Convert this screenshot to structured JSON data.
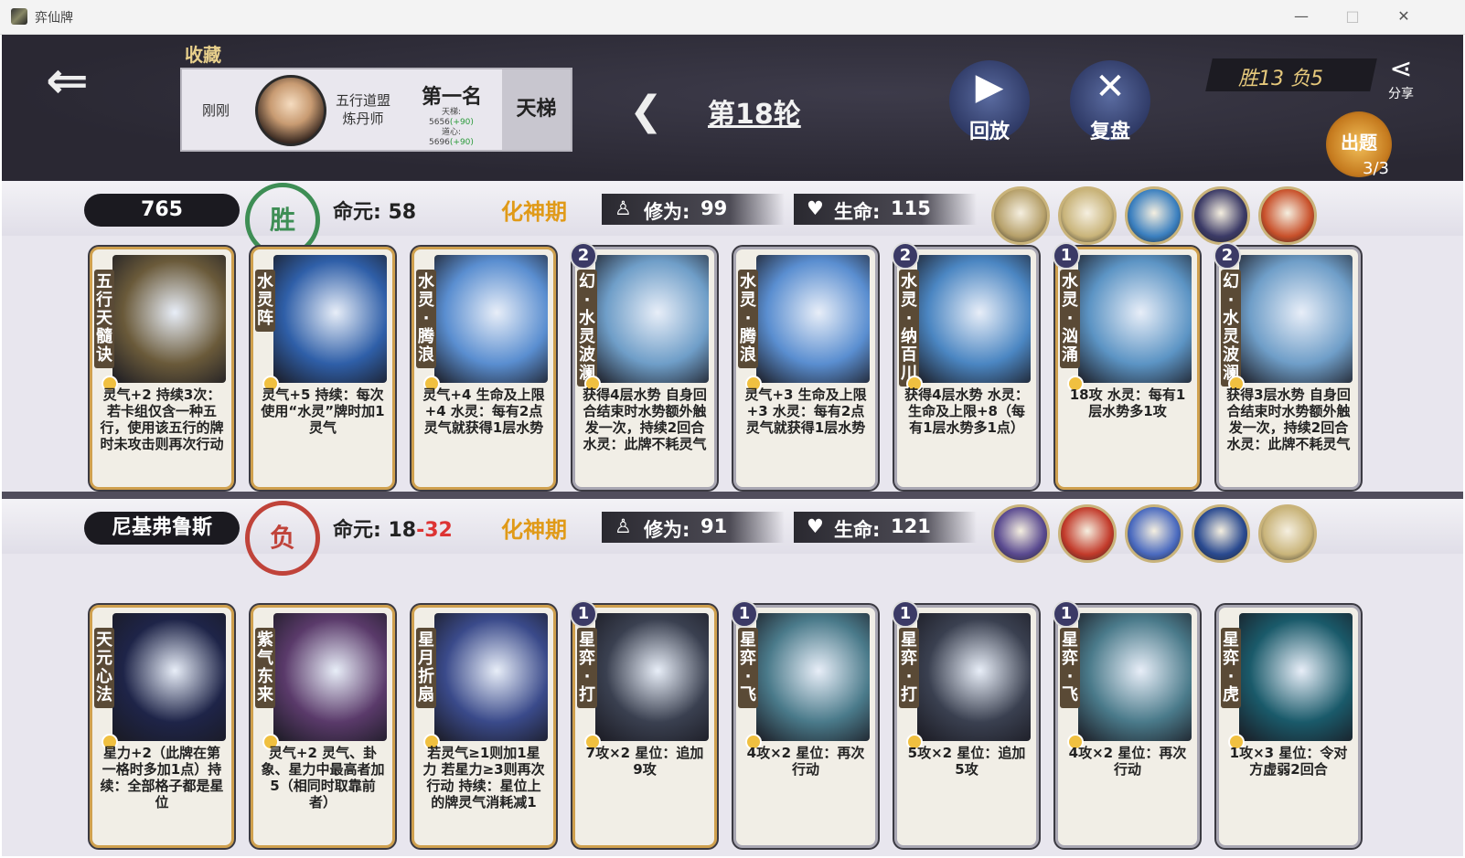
{
  "window": {
    "title": "弈仙牌",
    "minimize": "—",
    "maximize": "□",
    "close": "✕"
  },
  "topbar": {
    "favorites_label": "收藏",
    "favorite": {
      "time": "刚刚",
      "sect_line1": "五行道盟",
      "sect_line2": "炼丹师",
      "rank": "第一名",
      "ladder_line": "天梯:",
      "ladder_value": "5656",
      "ladder_delta": "(+90)",
      "daoxin_line": "道心:",
      "daoxin_value": "5696",
      "daoxin_delta": "(+90)",
      "ladder_button": "天梯"
    },
    "round": "第18轮",
    "replay_label": "回放",
    "review_label": "复盘",
    "record": "胜13  负5",
    "share_label": "分享",
    "quiz_label": "出题",
    "quiz_count": "3/3"
  },
  "player1": {
    "score": "765",
    "result": "胜",
    "life_label": "命元:",
    "life": "58",
    "realm": "化神期",
    "cultivation_label": "修为:",
    "cultivation": "99",
    "hp_label": "生命:",
    "hp": "115",
    "orb_colors": [
      "#b6a06a",
      "#c9b47a",
      "#3a7fbf",
      "#3b3a66",
      "#c8502a"
    ],
    "cards": [
      {
        "name": "五行天髓诀",
        "cost": "",
        "desc": "灵气+2 持续3次：若卡组仅含一种五行，使用该五行的牌时未攻击则再次行动",
        "art": "#6a5a3a",
        "gold": true
      },
      {
        "name": "水灵阵",
        "cost": "",
        "desc": "灵气+5 持续：每次使用“水灵”牌时加1灵气",
        "art": "#2f5fa8",
        "gold": true
      },
      {
        "name": "水灵·腾浪",
        "cost": "",
        "desc": "灵气+4 生命及上限+4 水灵：每有2点灵气就获得1层水势",
        "art": "#5a8ed0",
        "gold": true
      },
      {
        "name": "幻·水灵波澜",
        "cost": "2",
        "desc": "获得4层水势 自身回合结束时水势额外触发一次，持续2回合 水灵：此牌不耗灵气",
        "art": "#6f9ec8",
        "gold": false
      },
      {
        "name": "水灵·腾浪",
        "cost": "",
        "desc": "灵气+3 生命及上限+3 水灵：每有2点灵气就获得1层水势",
        "art": "#5a8ed0",
        "gold": false
      },
      {
        "name": "水灵·纳百川",
        "cost": "2",
        "desc": "获得4层水势 水灵：生命及上限+8（每有1层水势多1点）",
        "art": "#4b86c2",
        "gold": false
      },
      {
        "name": "水灵·汹涌",
        "cost": "1",
        "desc": "18攻 水灵：每有1层水势多1攻",
        "art": "#5c94c4",
        "gold": true
      },
      {
        "name": "幻·水灵波澜",
        "cost": "2",
        "desc": "获得3层水势 自身回合结束时水势额外触发一次，持续2回合 水灵：此牌不耗灵气",
        "art": "#6f9ec8",
        "gold": false
      }
    ]
  },
  "player2": {
    "name": "尼基弗鲁斯",
    "result": "负",
    "life_label": "命元:",
    "life_a": "18",
    "life_b": "-32",
    "realm": "化神期",
    "cultivation_label": "修为:",
    "cultivation": "91",
    "hp_label": "生命:",
    "hp": "121",
    "orb_colors": [
      "#5a4a90",
      "#c23a2a",
      "#4a6abf",
      "#2a4a90",
      "#c9b47a"
    ],
    "cards": [
      {
        "name": "天元心法",
        "cost": "",
        "desc": "星力+2（此牌在第一格时多加1点）持续：全部格子都是星位",
        "art": "#1e2448",
        "gold": true
      },
      {
        "name": "紫气东来",
        "cost": "",
        "desc": "灵气+2 灵气、卦象、星力中最高者加5（相同时取靠前者）",
        "art": "#5a3a6a",
        "gold": true
      },
      {
        "name": "星月折扇",
        "cost": "",
        "desc": "若灵气≥1则加1星力 若星力≥3则再次行动 持续：星位上的牌灵气消耗减1",
        "art": "#3a4a8a",
        "gold": true
      },
      {
        "name": "星弈·打",
        "cost": "1",
        "desc": "7攻×2 星位：追加9攻",
        "art": "#3a4050",
        "gold": true
      },
      {
        "name": "星弈·飞",
        "cost": "1",
        "desc": "4攻×2 星位：再次行动",
        "art": "#4a7a8a",
        "gold": false
      },
      {
        "name": "星弈·打",
        "cost": "1",
        "desc": "5攻×2 星位：追加5攻",
        "art": "#3a4050",
        "gold": false
      },
      {
        "name": "星弈·飞",
        "cost": "1",
        "desc": "4攻×2 星位：再次行动",
        "art": "#4a7a8a",
        "gold": false
      },
      {
        "name": "星弈·虎",
        "cost": "",
        "desc": "1攻×3 星位：令对方虚弱2回合",
        "art": "#1a5a6a",
        "gold": false
      }
    ]
  }
}
